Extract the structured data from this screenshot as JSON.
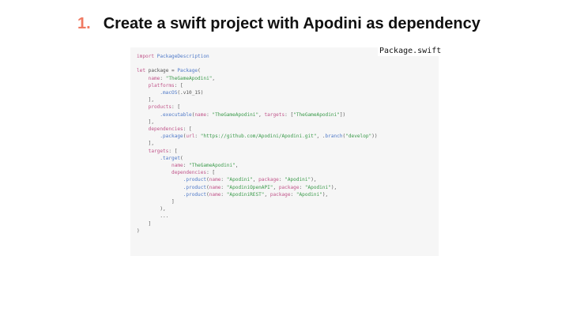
{
  "slide": {
    "number": "1.",
    "title": "Create a swift project with Apodini as dependency"
  },
  "code_panel": {
    "filename": "Package.swift",
    "lines": [
      {
        "parts": [
          {
            "t": "import",
            "c": "kw"
          },
          {
            "t": " PackageDescription",
            "c": "fn"
          }
        ]
      },
      {
        "parts": [
          {
            "t": "",
            "c": ""
          }
        ]
      },
      {
        "parts": [
          {
            "t": "let",
            "c": "kw"
          },
          {
            "t": " package = ",
            "c": ""
          },
          {
            "t": "Package",
            "c": "fn"
          },
          {
            "t": "(",
            "c": ""
          }
        ]
      },
      {
        "parts": [
          {
            "t": "    name",
            "c": "lbl"
          },
          {
            "t": ": ",
            "c": ""
          },
          {
            "t": "\"TheGameApodini\"",
            "c": "str"
          },
          {
            "t": ",",
            "c": ""
          }
        ]
      },
      {
        "parts": [
          {
            "t": "    platforms",
            "c": "lbl"
          },
          {
            "t": ": [",
            "c": ""
          }
        ]
      },
      {
        "parts": [
          {
            "t": "        .macOS",
            "c": "fn"
          },
          {
            "t": "(.v10_15)",
            "c": ""
          }
        ]
      },
      {
        "parts": [
          {
            "t": "    ],",
            "c": ""
          }
        ]
      },
      {
        "parts": [
          {
            "t": "    products",
            "c": "lbl"
          },
          {
            "t": ": [",
            "c": ""
          }
        ]
      },
      {
        "parts": [
          {
            "t": "        .executable",
            "c": "fn"
          },
          {
            "t": "(",
            "c": ""
          },
          {
            "t": "name",
            "c": "lbl"
          },
          {
            "t": ": ",
            "c": ""
          },
          {
            "t": "\"TheGameApodini\"",
            "c": "str"
          },
          {
            "t": ", ",
            "c": ""
          },
          {
            "t": "targets",
            "c": "lbl"
          },
          {
            "t": ": [",
            "c": ""
          },
          {
            "t": "\"TheGameApodini\"",
            "c": "str"
          },
          {
            "t": "])",
            "c": ""
          }
        ]
      },
      {
        "parts": [
          {
            "t": "    ],",
            "c": ""
          }
        ]
      },
      {
        "parts": [
          {
            "t": "    dependencies",
            "c": "lbl"
          },
          {
            "t": ": [",
            "c": ""
          }
        ]
      },
      {
        "parts": [
          {
            "t": "        .package",
            "c": "fn"
          },
          {
            "t": "(",
            "c": ""
          },
          {
            "t": "url",
            "c": "lbl"
          },
          {
            "t": ": ",
            "c": ""
          },
          {
            "t": "\"https://github.com/Apodini/Apodini.git\"",
            "c": "str"
          },
          {
            "t": ", .",
            "c": ""
          },
          {
            "t": "branch",
            "c": "fn"
          },
          {
            "t": "(",
            "c": ""
          },
          {
            "t": "\"develop\"",
            "c": "str"
          },
          {
            "t": "))",
            "c": ""
          }
        ]
      },
      {
        "parts": [
          {
            "t": "    ],",
            "c": ""
          }
        ]
      },
      {
        "parts": [
          {
            "t": "    targets",
            "c": "lbl"
          },
          {
            "t": ": [",
            "c": ""
          }
        ]
      },
      {
        "parts": [
          {
            "t": "        .target",
            "c": "fn"
          },
          {
            "t": "(",
            "c": ""
          }
        ]
      },
      {
        "parts": [
          {
            "t": "            name",
            "c": "lbl"
          },
          {
            "t": ": ",
            "c": ""
          },
          {
            "t": "\"TheGameApodini\"",
            "c": "str"
          },
          {
            "t": ",",
            "c": ""
          }
        ]
      },
      {
        "parts": [
          {
            "t": "            dependencies",
            "c": "lbl"
          },
          {
            "t": ": [",
            "c": ""
          }
        ]
      },
      {
        "parts": [
          {
            "t": "                .product",
            "c": "fn"
          },
          {
            "t": "(",
            "c": ""
          },
          {
            "t": "name",
            "c": "lbl"
          },
          {
            "t": ": ",
            "c": ""
          },
          {
            "t": "\"Apodini\"",
            "c": "str"
          },
          {
            "t": ", ",
            "c": ""
          },
          {
            "t": "package",
            "c": "lbl"
          },
          {
            "t": ": ",
            "c": ""
          },
          {
            "t": "\"Apodini\"",
            "c": "str"
          },
          {
            "t": "),",
            "c": ""
          }
        ]
      },
      {
        "parts": [
          {
            "t": "                .product",
            "c": "fn"
          },
          {
            "t": "(",
            "c": ""
          },
          {
            "t": "name",
            "c": "lbl"
          },
          {
            "t": ": ",
            "c": ""
          },
          {
            "t": "\"ApodiniOpenAPI\"",
            "c": "str"
          },
          {
            "t": ", ",
            "c": ""
          },
          {
            "t": "package",
            "c": "lbl"
          },
          {
            "t": ": ",
            "c": ""
          },
          {
            "t": "\"Apodini\"",
            "c": "str"
          },
          {
            "t": "),",
            "c": ""
          }
        ]
      },
      {
        "parts": [
          {
            "t": "                .product",
            "c": "fn"
          },
          {
            "t": "(",
            "c": ""
          },
          {
            "t": "name",
            "c": "lbl"
          },
          {
            "t": ": ",
            "c": ""
          },
          {
            "t": "\"ApodiniREST\"",
            "c": "str"
          },
          {
            "t": ", ",
            "c": ""
          },
          {
            "t": "package",
            "c": "lbl"
          },
          {
            "t": ": ",
            "c": ""
          },
          {
            "t": "\"Apodini\"",
            "c": "str"
          },
          {
            "t": "),",
            "c": ""
          }
        ]
      },
      {
        "parts": [
          {
            "t": "            ]",
            "c": ""
          }
        ]
      },
      {
        "parts": [
          {
            "t": "        ),",
            "c": ""
          }
        ]
      },
      {
        "parts": [
          {
            "t": "        ...",
            "c": ""
          }
        ]
      },
      {
        "parts": [
          {
            "t": "    ]",
            "c": ""
          }
        ]
      },
      {
        "parts": [
          {
            "t": ")",
            "c": ""
          }
        ]
      }
    ]
  }
}
